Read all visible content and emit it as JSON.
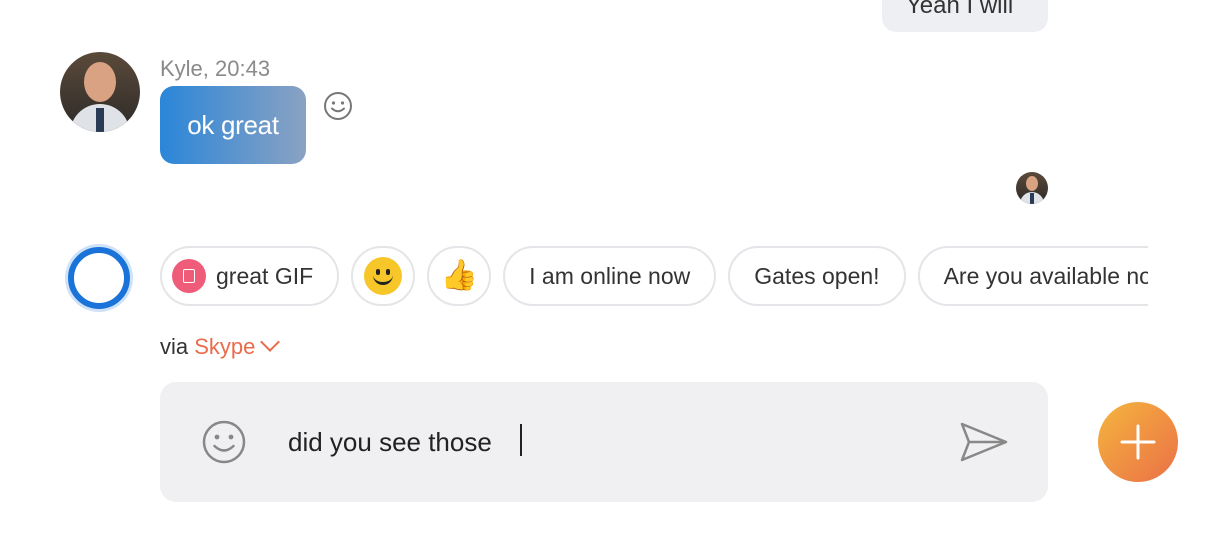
{
  "previous_message": {
    "text": "Yeah I will"
  },
  "message": {
    "sender_meta": "Kyle, 20:43",
    "text": "ok great"
  },
  "suggestions": [
    {
      "type": "gif",
      "label": "great GIF",
      "icon": "gif-icon"
    },
    {
      "type": "emoji",
      "icon": "smiley-emoji-icon"
    },
    {
      "type": "emoji",
      "icon": "thumbs-up-emoji-icon"
    },
    {
      "type": "text",
      "label": "I am online now"
    },
    {
      "type": "text",
      "label": "Gates open!"
    },
    {
      "type": "text",
      "label": "Are you available no"
    }
  ],
  "via": {
    "prefix": "via",
    "service": "Skype"
  },
  "composer": {
    "value": "did you see those"
  },
  "colors": {
    "bubble_gradient_start": "#2b86d9",
    "bubble_gradient_end": "#8aa2c2",
    "cortana_blue": "#1a73d9",
    "brand_orange": "#ea6b4c",
    "fab_start": "#f5b53d",
    "fab_end": "#ea7047"
  }
}
